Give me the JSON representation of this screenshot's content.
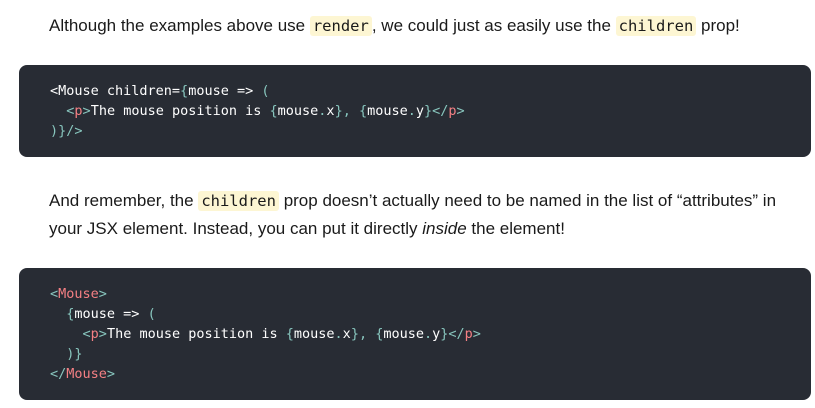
{
  "paragraph_1": {
    "before": "Although the examples above use ",
    "code_1": "render",
    "middle": ", we could just as easily use the ",
    "code_2": "children",
    "after": " prop!"
  },
  "code_block_1": {
    "line_1": {
      "a": "<Mouse children=",
      "b": "{",
      "c": "mouse => ",
      "d": "("
    },
    "line_2": {
      "indent": "  ",
      "a": "<",
      "b": "p",
      "c": ">",
      "d": "The mouse position is ",
      "e": "{",
      "f": "mouse",
      "g": ".",
      "h": "x",
      "i": "}, {",
      "j": "mouse",
      "k": ".",
      "l": "y",
      "m": "}</",
      "n": "p",
      "o": ">"
    },
    "line_3": {
      "a": ")}",
      "b": "/>"
    }
  },
  "paragraph_2": {
    "before": "And remember, the ",
    "code": "children",
    "middle": " prop doesn’t actually need to be named in the list of “attributes” in your JSX element. Instead, you can put it directly ",
    "emphasis": "inside",
    "after": " the element!"
  },
  "code_block_2": {
    "line_1": {
      "a": "<",
      "b": "Mouse",
      "c": ">"
    },
    "line_2": {
      "indent": "  ",
      "a": "{",
      "b": "mouse => ",
      "c": "("
    },
    "line_3": {
      "indent": "    ",
      "a": "<",
      "b": "p",
      "c": ">",
      "d": "The mouse position is ",
      "e": "{",
      "f": "mouse",
      "g": ".",
      "h": "x",
      "i": "}, {",
      "j": "mouse",
      "k": ".",
      "l": "y",
      "m": "}</",
      "n": "p",
      "o": ">"
    },
    "line_4": {
      "indent": "  ",
      "a": ")}"
    },
    "line_5": {
      "a": "</",
      "b": "Mouse",
      "c": ">"
    }
  }
}
